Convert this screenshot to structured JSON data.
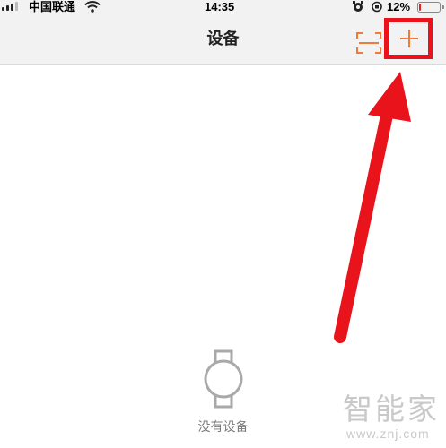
{
  "status_bar": {
    "carrier": "中国联通",
    "time": "14:35",
    "battery_percent": "12%",
    "battery_level": 0.12,
    "battery_color": "#e02020",
    "icons": [
      "signal-icon",
      "wifi-icon",
      "alarm-icon",
      "rotation-lock-icon",
      "battery-icon"
    ]
  },
  "nav": {
    "title": "设备",
    "scan_icon": "scan-icon",
    "add_icon": "plus-icon",
    "accent_color": "#f07a3c"
  },
  "annotation": {
    "highlight_color": "#e8131b",
    "arrow_color": "#e8131b"
  },
  "empty_state": {
    "icon": "watch-icon",
    "text": "没有设备"
  },
  "watermark": {
    "logo_text": "智能家",
    "url": "www.znj.com"
  }
}
